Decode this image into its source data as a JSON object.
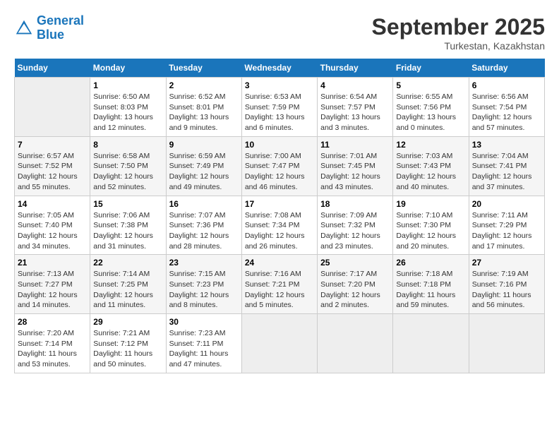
{
  "header": {
    "logo_line1": "General",
    "logo_line2": "Blue",
    "month": "September 2025",
    "location": "Turkestan, Kazakhstan"
  },
  "days_of_week": [
    "Sunday",
    "Monday",
    "Tuesday",
    "Wednesday",
    "Thursday",
    "Friday",
    "Saturday"
  ],
  "weeks": [
    [
      {
        "num": "",
        "info": ""
      },
      {
        "num": "1",
        "info": "Sunrise: 6:50 AM\nSunset: 8:03 PM\nDaylight: 13 hours\nand 12 minutes."
      },
      {
        "num": "2",
        "info": "Sunrise: 6:52 AM\nSunset: 8:01 PM\nDaylight: 13 hours\nand 9 minutes."
      },
      {
        "num": "3",
        "info": "Sunrise: 6:53 AM\nSunset: 7:59 PM\nDaylight: 13 hours\nand 6 minutes."
      },
      {
        "num": "4",
        "info": "Sunrise: 6:54 AM\nSunset: 7:57 PM\nDaylight: 13 hours\nand 3 minutes."
      },
      {
        "num": "5",
        "info": "Sunrise: 6:55 AM\nSunset: 7:56 PM\nDaylight: 13 hours\nand 0 minutes."
      },
      {
        "num": "6",
        "info": "Sunrise: 6:56 AM\nSunset: 7:54 PM\nDaylight: 12 hours\nand 57 minutes."
      }
    ],
    [
      {
        "num": "7",
        "info": "Sunrise: 6:57 AM\nSunset: 7:52 PM\nDaylight: 12 hours\nand 55 minutes."
      },
      {
        "num": "8",
        "info": "Sunrise: 6:58 AM\nSunset: 7:50 PM\nDaylight: 12 hours\nand 52 minutes."
      },
      {
        "num": "9",
        "info": "Sunrise: 6:59 AM\nSunset: 7:49 PM\nDaylight: 12 hours\nand 49 minutes."
      },
      {
        "num": "10",
        "info": "Sunrise: 7:00 AM\nSunset: 7:47 PM\nDaylight: 12 hours\nand 46 minutes."
      },
      {
        "num": "11",
        "info": "Sunrise: 7:01 AM\nSunset: 7:45 PM\nDaylight: 12 hours\nand 43 minutes."
      },
      {
        "num": "12",
        "info": "Sunrise: 7:03 AM\nSunset: 7:43 PM\nDaylight: 12 hours\nand 40 minutes."
      },
      {
        "num": "13",
        "info": "Sunrise: 7:04 AM\nSunset: 7:41 PM\nDaylight: 12 hours\nand 37 minutes."
      }
    ],
    [
      {
        "num": "14",
        "info": "Sunrise: 7:05 AM\nSunset: 7:40 PM\nDaylight: 12 hours\nand 34 minutes."
      },
      {
        "num": "15",
        "info": "Sunrise: 7:06 AM\nSunset: 7:38 PM\nDaylight: 12 hours\nand 31 minutes."
      },
      {
        "num": "16",
        "info": "Sunrise: 7:07 AM\nSunset: 7:36 PM\nDaylight: 12 hours\nand 28 minutes."
      },
      {
        "num": "17",
        "info": "Sunrise: 7:08 AM\nSunset: 7:34 PM\nDaylight: 12 hours\nand 26 minutes."
      },
      {
        "num": "18",
        "info": "Sunrise: 7:09 AM\nSunset: 7:32 PM\nDaylight: 12 hours\nand 23 minutes."
      },
      {
        "num": "19",
        "info": "Sunrise: 7:10 AM\nSunset: 7:30 PM\nDaylight: 12 hours\nand 20 minutes."
      },
      {
        "num": "20",
        "info": "Sunrise: 7:11 AM\nSunset: 7:29 PM\nDaylight: 12 hours\nand 17 minutes."
      }
    ],
    [
      {
        "num": "21",
        "info": "Sunrise: 7:13 AM\nSunset: 7:27 PM\nDaylight: 12 hours\nand 14 minutes."
      },
      {
        "num": "22",
        "info": "Sunrise: 7:14 AM\nSunset: 7:25 PM\nDaylight: 12 hours\nand 11 minutes."
      },
      {
        "num": "23",
        "info": "Sunrise: 7:15 AM\nSunset: 7:23 PM\nDaylight: 12 hours\nand 8 minutes."
      },
      {
        "num": "24",
        "info": "Sunrise: 7:16 AM\nSunset: 7:21 PM\nDaylight: 12 hours\nand 5 minutes."
      },
      {
        "num": "25",
        "info": "Sunrise: 7:17 AM\nSunset: 7:20 PM\nDaylight: 12 hours\nand 2 minutes."
      },
      {
        "num": "26",
        "info": "Sunrise: 7:18 AM\nSunset: 7:18 PM\nDaylight: 11 hours\nand 59 minutes."
      },
      {
        "num": "27",
        "info": "Sunrise: 7:19 AM\nSunset: 7:16 PM\nDaylight: 11 hours\nand 56 minutes."
      }
    ],
    [
      {
        "num": "28",
        "info": "Sunrise: 7:20 AM\nSunset: 7:14 PM\nDaylight: 11 hours\nand 53 minutes."
      },
      {
        "num": "29",
        "info": "Sunrise: 7:21 AM\nSunset: 7:12 PM\nDaylight: 11 hours\nand 50 minutes."
      },
      {
        "num": "30",
        "info": "Sunrise: 7:23 AM\nSunset: 7:11 PM\nDaylight: 11 hours\nand 47 minutes."
      },
      {
        "num": "",
        "info": ""
      },
      {
        "num": "",
        "info": ""
      },
      {
        "num": "",
        "info": ""
      },
      {
        "num": "",
        "info": ""
      }
    ]
  ]
}
